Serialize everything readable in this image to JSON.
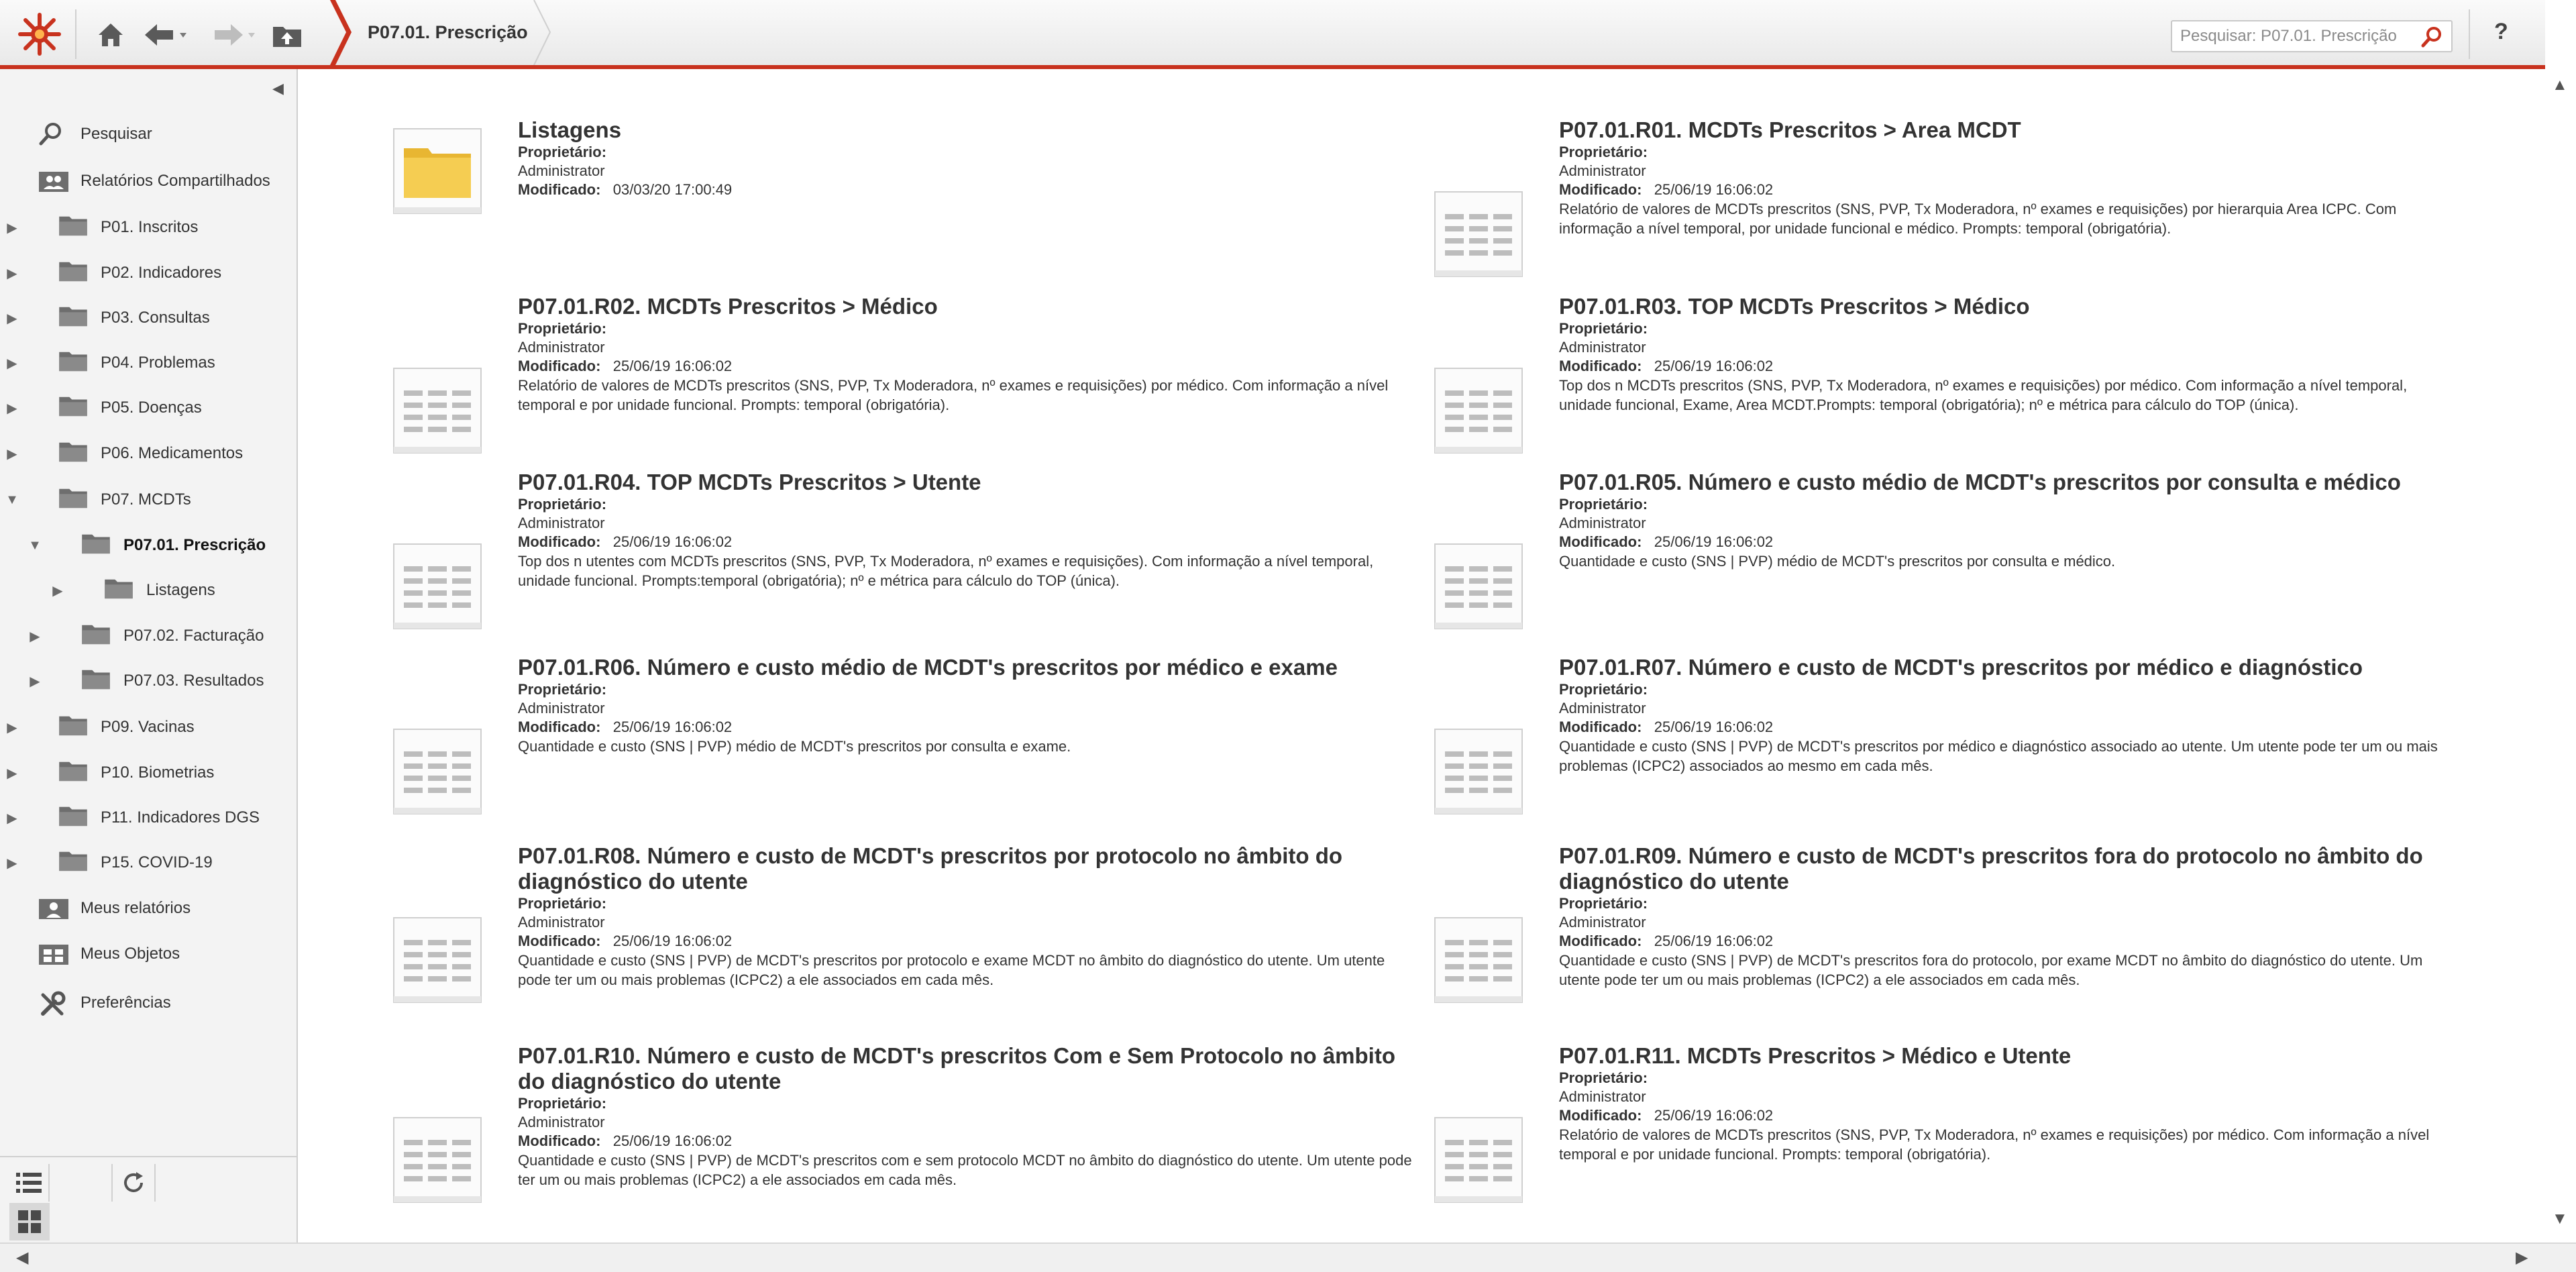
{
  "topbar": {
    "breadcrumb": "P07.01. Prescrição",
    "search_placeholder": "Pesquisar: P07.01. Prescrição",
    "help_label": "?"
  },
  "sidebar": {
    "items": [
      {
        "label": "Pesquisar",
        "icon": "search-icon",
        "level": 0,
        "expand": ""
      },
      {
        "label": "Relatórios Compartilhados",
        "icon": "shared-reports-icon",
        "level": 0,
        "expand": ""
      },
      {
        "label": "P01. Inscritos",
        "icon": "folder-icon",
        "level": 1,
        "expand": "▶"
      },
      {
        "label": "P02. Indicadores",
        "icon": "folder-icon",
        "level": 1,
        "expand": "▶"
      },
      {
        "label": "P03. Consultas",
        "icon": "folder-icon",
        "level": 1,
        "expand": "▶"
      },
      {
        "label": "P04. Problemas",
        "icon": "folder-icon",
        "level": 1,
        "expand": "▶"
      },
      {
        "label": "P05. Doenças",
        "icon": "folder-icon",
        "level": 1,
        "expand": "▶"
      },
      {
        "label": "P06. Medicamentos",
        "icon": "folder-icon",
        "level": 1,
        "expand": "▶"
      },
      {
        "label": "P07. MCDTs",
        "icon": "folder-icon",
        "level": 1,
        "expand": "▼"
      },
      {
        "label": "P07.01. Prescrição",
        "icon": "folder-icon",
        "level": 2,
        "expand": "▼"
      },
      {
        "label": "Listagens",
        "icon": "folder-icon",
        "level": 3,
        "expand": "▶"
      },
      {
        "label": "P07.02. Facturação",
        "icon": "folder-icon",
        "level": 2,
        "expand": "▶"
      },
      {
        "label": "P07.03. Resultados",
        "icon": "folder-icon",
        "level": 2,
        "expand": "▶"
      },
      {
        "label": "P09.  Vacinas",
        "icon": "folder-icon",
        "level": 1,
        "expand": "▶"
      },
      {
        "label": "P10. Biometrias",
        "icon": "folder-icon",
        "level": 1,
        "expand": "▶"
      },
      {
        "label": "P11. Indicadores DGS",
        "icon": "folder-icon",
        "level": 1,
        "expand": "▶"
      },
      {
        "label": "P15. COVID-19",
        "icon": "folder-icon",
        "level": 1,
        "expand": "▶"
      },
      {
        "label": "Meus relatórios",
        "icon": "my-reports-icon",
        "level": 0,
        "expand": ""
      },
      {
        "label": "Meus Objetos",
        "icon": "my-objects-icon",
        "level": 0,
        "expand": ""
      },
      {
        "label": "Preferências",
        "icon": "tools-icon",
        "level": 0,
        "expand": ""
      }
    ]
  },
  "labels": {
    "owner": "Proprietário:",
    "modified": "Modificado:"
  },
  "cards": [
    {
      "title": "Listagens",
      "owner": "Administrator",
      "modified": "03/03/20 17:00:49",
      "desc": "",
      "kind": "folder"
    },
    {
      "title": "P07.01.R01. MCDTs Prescritos > Area MCDT",
      "owner": "Administrator",
      "modified": "25/06/19 16:06:02",
      "desc": "Relatório de valores de MCDTs prescritos (SNS, PVP, Tx Moderadora, nº exames e requisições) por hierarquia Area ICPC. Com informação a nível temporal, por unidade funcional e médico. Prompts: temporal (obrigatória).",
      "kind": "report"
    },
    {
      "title": "P07.01.R02. MCDTs Prescritos > Médico",
      "owner": "Administrator",
      "modified": "25/06/19 16:06:02",
      "desc": "Relatório de valores de MCDTs prescritos (SNS, PVP, Tx Moderadora, nº exames e requisições) por médico. Com informação a nível temporal e por unidade funcional. Prompts: temporal (obrigatória).",
      "kind": "report"
    },
    {
      "title": "P07.01.R03. TOP MCDTs Prescritos > Médico",
      "owner": "Administrator",
      "modified": "25/06/19 16:06:02",
      "desc": "Top dos n MCDTs prescritos (SNS, PVP, Tx Moderadora, nº exames e requisições) por médico. Com informação a nível temporal, unidade funcional, Exame, Area MCDT.Prompts: temporal (obrigatória); nº e métrica para cálculo do TOP (única).",
      "kind": "report"
    },
    {
      "title": "P07.01.R04. TOP MCDTs Prescritos > Utente",
      "owner": "Administrator",
      "modified": "25/06/19 16:06:02",
      "desc": "Top dos n utentes com MCDTs prescritos (SNS, PVP, Tx Moderadora, nº exames e requisições). Com informação a nível temporal, unidade funcional. Prompts:temporal (obrigatória); nº e métrica para cálculo do TOP (única).",
      "kind": "report"
    },
    {
      "title": "P07.01.R05. Número e custo médio de MCDT's prescritos por consulta e médico",
      "owner": "Administrator",
      "modified": "25/06/19 16:06:02",
      "desc": "Quantidade e custo (SNS | PVP) médio de MCDT's prescritos por consulta e médico.",
      "kind": "report"
    },
    {
      "title": "P07.01.R06. Número e custo médio de MCDT's prescritos por médico e exame",
      "owner": "Administrator",
      "modified": "25/06/19 16:06:02",
      "desc": "Quantidade e custo (SNS | PVP) médio de MCDT's prescritos por consulta e exame.",
      "kind": "report"
    },
    {
      "title": "P07.01.R07. Número e custo de MCDT's prescritos por médico e diagnóstico",
      "owner": "Administrator",
      "modified": "25/06/19 16:06:02",
      "desc": "Quantidade e custo (SNS | PVP) de MCDT's prescritos por médico e diagnóstico associado ao utente. Um utente pode ter um ou mais problemas (ICPC2) associados ao mesmo em cada mês.",
      "kind": "report"
    },
    {
      "title": "P07.01.R08. Número e custo de MCDT's prescritos por protocolo no âmbito do diagnóstico do utente",
      "owner": "Administrator",
      "modified": "25/06/19 16:06:02",
      "desc": "Quantidade e custo (SNS | PVP) de MCDT's prescritos por protocolo e exame MCDT no âmbito do diagnóstico do utente. Um utente pode ter um ou mais problemas (ICPC2) a ele associados em cada mês.",
      "kind": "report"
    },
    {
      "title": "P07.01.R09. Número e custo de MCDT's prescritos fora do protocolo no âmbito do diagnóstico do utente",
      "owner": "Administrator",
      "modified": "25/06/19 16:06:02",
      "desc": "Quantidade e custo (SNS | PVP) de MCDT's prescritos fora do protocolo, por exame MCDT no âmbito do diagnóstico do utente. Um utente pode ter um ou mais problemas (ICPC2) a ele associados em cada mês.",
      "kind": "report"
    },
    {
      "title": "P07.01.R10. Número e custo de MCDT's prescritos Com e Sem Protocolo no âmbito do diagnóstico do utente",
      "owner": "Administrator",
      "modified": "25/06/19 16:06:02",
      "desc": "Quantidade e custo (SNS | PVP) de MCDT's prescritos com e sem protocolo MCDT no âmbito do diagnóstico do utente. Um utente pode ter um ou mais problemas (ICPC2) a ele associados em cada mês.",
      "kind": "report"
    },
    {
      "title": "P07.01.R11. MCDTs Prescritos > Médico e Utente",
      "owner": "Administrator",
      "modified": "25/06/19 16:06:02",
      "desc": "Relatório de valores de MCDTs prescritos (SNS, PVP, Tx Moderadora, nº exames e requisições) por médico. Com informação a nível temporal e por unidade funcional. Prompts: temporal (obrigatória).",
      "kind": "report"
    }
  ],
  "colors": {
    "accent": "#c8321e",
    "folder": "#f3c74a",
    "sidebar_bg": "#f3f3f3"
  }
}
